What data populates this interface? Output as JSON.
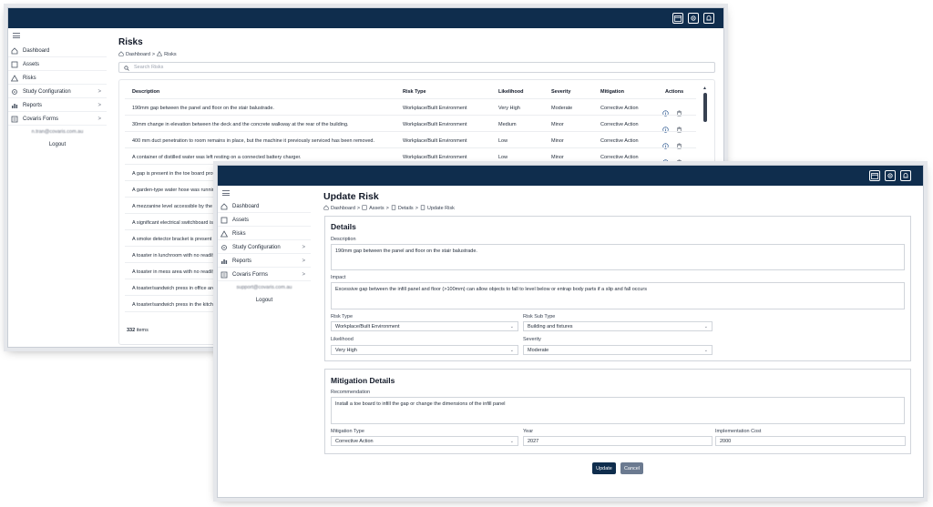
{
  "colors": {
    "topbar": "#0f2d4d",
    "primary_button": "#0f2d4d",
    "secondary_button": "#6b7a90"
  },
  "back_window": {
    "sidebar": {
      "items": [
        {
          "label": "Dashboard",
          "icon": "home-icon"
        },
        {
          "label": "Assets",
          "icon": "square-icon"
        },
        {
          "label": "Risks",
          "icon": "warning-icon"
        },
        {
          "label": "Study Configuration",
          "icon": "gear-icon",
          "chevron": ">"
        },
        {
          "label": "Reports",
          "icon": "chart-icon",
          "chevron": ">"
        },
        {
          "label": "Covaris Forms",
          "icon": "form-icon",
          "chevron": ">"
        }
      ],
      "user_email": "n.tran@covaris.com.au",
      "logout": "Logout"
    },
    "page_title": "Risks",
    "breadcrumb": {
      "home": "Dashboard",
      "sep": ">",
      "current": "Risks"
    },
    "search": {
      "placeholder": "Search Risks"
    },
    "table": {
      "headers": [
        "Description",
        "Risk Type",
        "Likelihood",
        "Severity",
        "Mitigation",
        "Actions"
      ],
      "rows": [
        [
          "190mm gap between the panel and floor on the stair balustrade.",
          "Workplace/Built Environment",
          "Very High",
          "Moderate",
          "Corrective Action"
        ],
        [
          "30mm change in elevation between the deck and the concrete walkway at the rear of the building.",
          "Workplace/Built Environment",
          "Medium",
          "Minor",
          "Corrective Action"
        ],
        [
          "400 mm duct penetration to room remains in place, but the machine it previously serviced has been removed.",
          "Workplace/Built Environment",
          "Low",
          "Minor",
          "Corrective Action"
        ],
        [
          "A container of distilled water was left resting on a connected battery charger.",
          "Workplace/Built Environment",
          "Low",
          "Minor",
          "Corrective Action"
        ],
        [
          "A gap is present in the toe board prote",
          "",
          "",
          "",
          ""
        ],
        [
          "A garden-type water hose was running",
          "",
          "",
          "",
          ""
        ],
        [
          "A mezzanine level accessible by the ha",
          "",
          "",
          "",
          ""
        ],
        [
          "A significant electrical switchboard is a",
          "",
          "",
          "",
          ""
        ],
        [
          "A smoke detector bracket is present o",
          "",
          "",
          "",
          ""
        ],
        [
          "A toaster in lunchroom with no readily",
          "",
          "",
          "",
          ""
        ],
        [
          "A toaster in mess area with no readily",
          "",
          "",
          "",
          ""
        ],
        [
          "A toaster/sandwich press in office area",
          "",
          "",
          "",
          ""
        ],
        [
          "A toaster/sandwich press in the kitchen",
          "",
          "",
          "",
          ""
        ]
      ],
      "count": "332",
      "count_suffix": "items"
    }
  },
  "front_window": {
    "sidebar": {
      "items": [
        {
          "label": "Dashboard",
          "icon": "home-icon"
        },
        {
          "label": "Assets",
          "icon": "square-icon"
        },
        {
          "label": "Risks",
          "icon": "warning-icon"
        },
        {
          "label": "Study Configuration",
          "icon": "gear-icon",
          "chevron": ">"
        },
        {
          "label": "Reports",
          "icon": "chart-icon",
          "chevron": ">"
        },
        {
          "label": "Covaris Forms",
          "icon": "form-icon",
          "chevron": ">"
        }
      ],
      "user_email": "support@covaris.com.au",
      "logout": "Logout"
    },
    "page_title": "Update Risk",
    "breadcrumb": [
      "Dashboard",
      "Assets",
      "Details",
      "Update Risk"
    ],
    "details": {
      "title": "Details",
      "description_label": "Description",
      "description_value": "190mm gap between the panel and floor on the stair balustrade.",
      "impact_label": "Impact",
      "impact_value": "Excessive gap between the infill panel and floor (>100mm) can allow objects to fall to level below or entrap body parts if a slip and fall occurs",
      "risk_type_label": "Risk Type",
      "risk_type_value": "Workplace/Built Environment",
      "risk_sub_type_label": "Risk Sub Type",
      "risk_sub_type_value": "Building and fixtures",
      "likelihood_label": "Likelihood",
      "likelihood_value": "Very High",
      "severity_label": "Severity",
      "severity_value": "Moderate"
    },
    "mitigation": {
      "title": "Mitigation Details",
      "recommendation_label": "Recommendation",
      "recommendation_value": "Install a toe board to infill the gap or change the dimensions of the infill panel",
      "type_label": "Mitigation Type",
      "type_value": "Corrective Action",
      "year_label": "Year",
      "year_value": "2027",
      "cost_label": "Implementation Cost",
      "cost_value": "2000"
    },
    "buttons": {
      "update": "Update",
      "cancel": "Cancel"
    }
  }
}
